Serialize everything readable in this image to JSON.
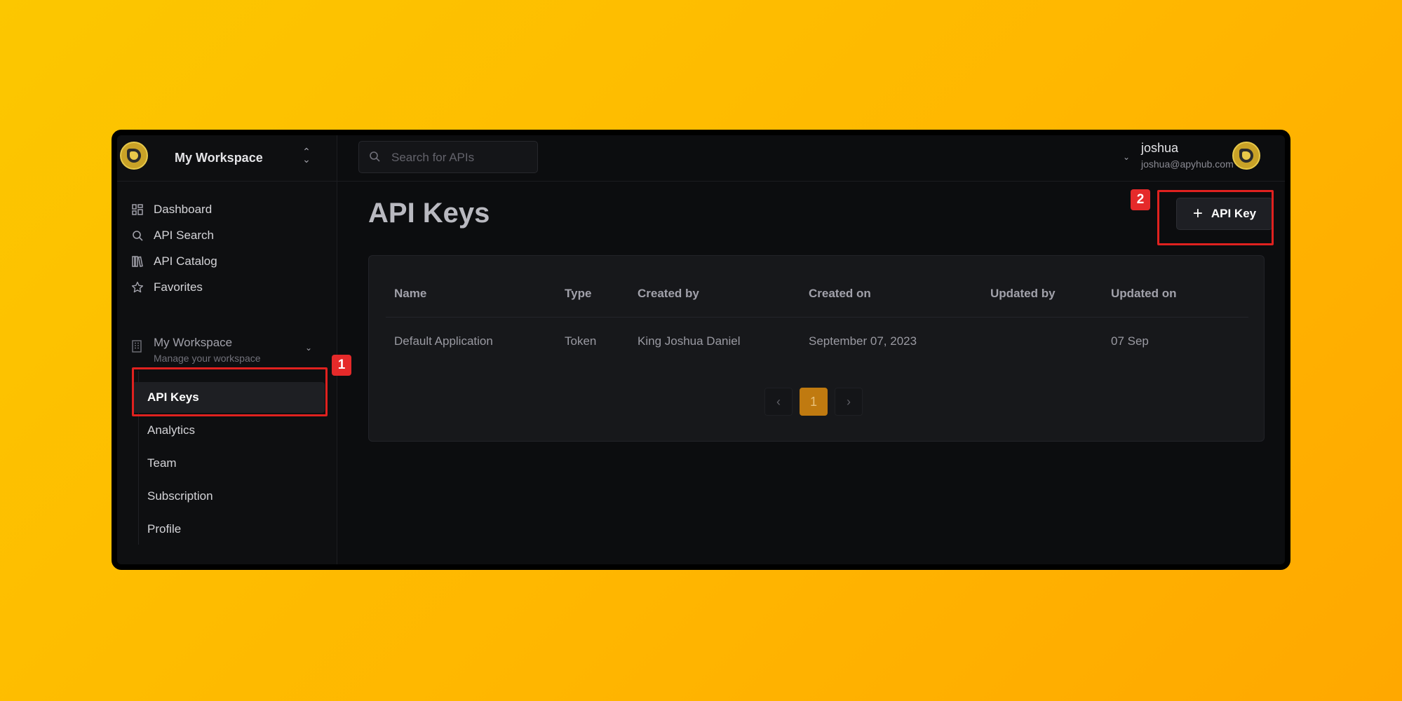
{
  "workspace": {
    "name": "My Workspace"
  },
  "search": {
    "placeholder": "Search for APIs",
    "value": ""
  },
  "user": {
    "name": "joshua",
    "email": "joshua@apyhub.com"
  },
  "sidebar": {
    "items": [
      {
        "label": "Dashboard",
        "icon": "grid-icon"
      },
      {
        "label": "API Search",
        "icon": "search-icon"
      },
      {
        "label": "API Catalog",
        "icon": "book-icon"
      },
      {
        "label": "Favorites",
        "icon": "star-icon"
      }
    ],
    "group": {
      "title": "My Workspace",
      "subtitle": "Manage your workspace",
      "icon": "building-icon"
    },
    "subitems": [
      {
        "label": "API Keys",
        "active": true
      },
      {
        "label": "Analytics"
      },
      {
        "label": "Team"
      },
      {
        "label": "Subscription"
      },
      {
        "label": "Profile"
      }
    ]
  },
  "main": {
    "title": "API Keys",
    "add_button_label": "API Key",
    "table": {
      "headers": [
        "Name",
        "Type",
        "Created by",
        "Created on",
        "Updated by",
        "Updated on"
      ],
      "rows": [
        [
          "Default Application",
          "Token",
          "King Joshua Daniel",
          "September 07, 2023",
          "",
          "07 Sep"
        ]
      ]
    },
    "pagination": {
      "current": "1",
      "prev": "‹",
      "next": "›"
    }
  },
  "annotations": [
    "1",
    "2"
  ],
  "colors": {
    "background": "#ffb700",
    "highlight": "#e0211f",
    "accent": "#c07a10"
  }
}
